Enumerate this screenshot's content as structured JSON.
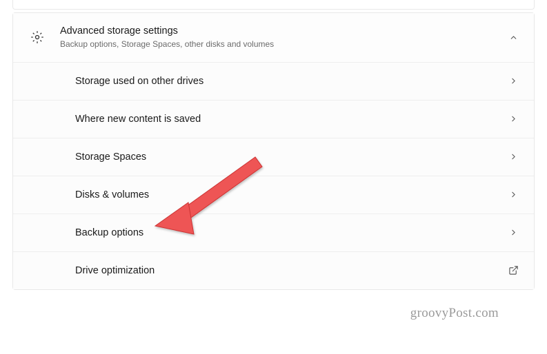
{
  "header": {
    "title": "Advanced storage settings",
    "subtitle": "Backup options, Storage Spaces, other disks and volumes"
  },
  "items": [
    {
      "label": "Storage used on other drives",
      "action": "chevron"
    },
    {
      "label": "Where new content is saved",
      "action": "chevron"
    },
    {
      "label": "Storage Spaces",
      "action": "chevron"
    },
    {
      "label": "Disks & volumes",
      "action": "chevron"
    },
    {
      "label": "Backup options",
      "action": "chevron"
    },
    {
      "label": "Drive optimization",
      "action": "external"
    }
  ],
  "watermark": "groovyPost.com"
}
